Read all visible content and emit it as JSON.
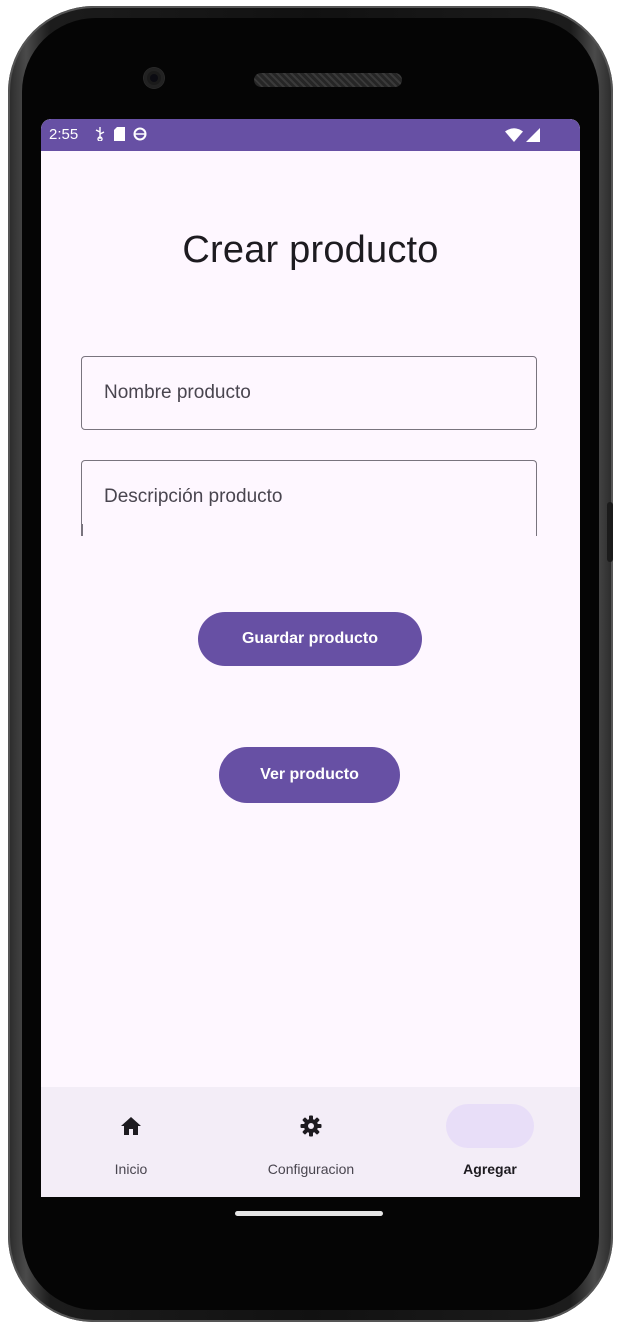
{
  "status_bar": {
    "time": "2:55",
    "left_icons": [
      "usb-icon",
      "sd-card-icon",
      "sync-icon"
    ],
    "right_icons": [
      "wifi-icon",
      "signal-icon"
    ],
    "color": "#6750a4"
  },
  "page": {
    "title": "Crear producto"
  },
  "form": {
    "name_field": {
      "placeholder": "Nombre producto",
      "value": ""
    },
    "description_field": {
      "placeholder": "Descripción producto",
      "value": ""
    }
  },
  "buttons": {
    "save_label": "Guardar producto",
    "view_label": "Ver producto"
  },
  "bottom_nav": {
    "items": [
      {
        "label": "Inicio",
        "icon": "home-icon",
        "active": false
      },
      {
        "label": "Configuracion",
        "icon": "gear-icon",
        "active": false
      },
      {
        "label": "Agregar",
        "icon": "",
        "active": true
      }
    ]
  },
  "colors": {
    "primary": "#6750a4",
    "background": "#fef7ff",
    "nav_background": "#f3edf7",
    "active_indicator": "#e8def8",
    "outline": "#79747e"
  }
}
